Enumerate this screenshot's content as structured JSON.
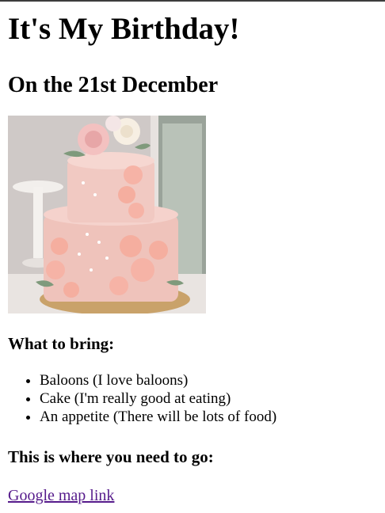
{
  "page": {
    "title": "It's My Birthday!",
    "date_heading": "On the 21st December",
    "bring_heading": "What to bring:",
    "bring_items": [
      "Baloons (I love baloons)",
      "Cake (I'm really good at eating)",
      "An appetite (There will be lots of food)"
    ],
    "location_heading": "This is where you need to go:",
    "map_link_text": "Google map link"
  },
  "colors": {
    "link_visited": "#551a8b",
    "cake_frosting": "#f0c4bd"
  }
}
